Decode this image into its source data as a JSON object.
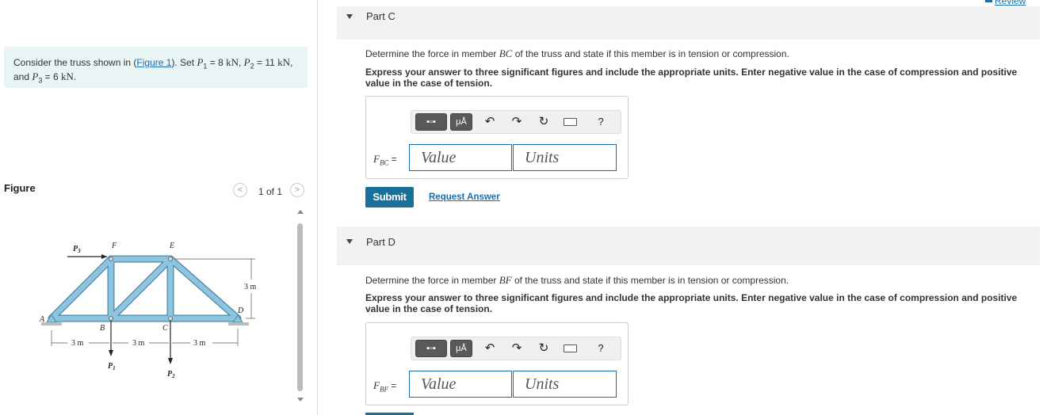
{
  "problem": {
    "intro": "Consider the truss shown in (",
    "figure_link": "Figure 1",
    "set_text": "). Set ",
    "p1": "P",
    "p1_sub": "1",
    "p1_val": " = 8 ",
    "p1_unit": "kN",
    "p2": "P",
    "p2_sub": "2",
    "p2_val": " = 11 ",
    "p2_unit": "kN",
    "and": "and ",
    "p3": "P",
    "p3_sub": "3",
    "p3_val": " = 6 ",
    "p3_unit": "kN"
  },
  "figure": {
    "label": "Figure",
    "counter": "1 of 1",
    "prev": "<",
    "next": ">",
    "nodes": {
      "a": "A",
      "b": "B",
      "c": "C",
      "d": "D",
      "e": "E",
      "f": "F"
    },
    "loads": {
      "p3": "P",
      "p3_sub": "3",
      "p1": "P",
      "p1_sub": "1",
      "p2": "P",
      "p2_sub": "2"
    },
    "dims": {
      "span1": "3 m",
      "span2": "3 m",
      "span3": "3 m",
      "height": "3 m"
    },
    "colors": {
      "member": "#8ec4de",
      "member_edge": "#4a88a8"
    }
  },
  "review": {
    "label": "Review"
  },
  "part_c": {
    "title": "Part C",
    "question_pre": "Determine the force in member ",
    "member": "BC",
    "question_post": " of the truss and state if this member is in tension or compression.",
    "instructions": "Express your answer to three significant figures and include the appropriate units. Enter negative value in the case of compression and positive value in the case of tension.",
    "var": "F",
    "var_sub": "BC",
    "eq": " =",
    "value_placeholder": "Value",
    "units_placeholder": "Units",
    "submit": "Submit",
    "request": "Request Answer"
  },
  "part_d": {
    "title": "Part D",
    "question_pre": "Determine the force in member ",
    "member": "BF",
    "question_post": " of the truss and state if this member is in tension or compression.",
    "instructions": "Express your answer to three significant figures and include the appropriate units. Enter negative value in the case of compression and positive value in the case of tension.",
    "var": "F",
    "var_sub": "BF",
    "eq": " =",
    "value_placeholder": "Value",
    "units_placeholder": "Units"
  },
  "toolbar": {
    "units_btn": "μÅ",
    "undo": "↶",
    "redo": "↷",
    "reset": "↻",
    "help": "?"
  }
}
